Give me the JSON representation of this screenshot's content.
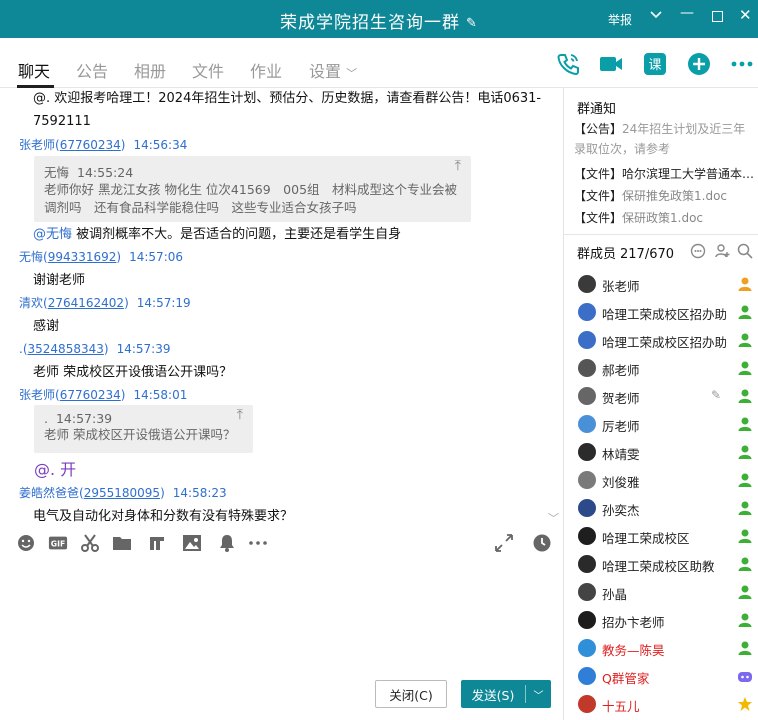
{
  "window": {
    "title": "荣成学院招生咨询一群",
    "report_label": "举报",
    "colors": {
      "titlebar": "#0e8896",
      "accent": "#0a9ea8",
      "link": "#2f6fcf"
    }
  },
  "tabs": [
    {
      "label": "聊天",
      "active": true
    },
    {
      "label": "公告"
    },
    {
      "label": "相册"
    },
    {
      "label": "文件"
    },
    {
      "label": "作业"
    },
    {
      "label": "设置"
    }
  ],
  "chat": {
    "m1_text_line1": "@. 欢迎报考哈理工！2024年招生计划、预估分、历史数据，请查看群公告！电话0631-",
    "m1_text_line2": "7592111",
    "s2": {
      "name": "张老师",
      "qq": "67760234",
      "time": "14:56:34"
    },
    "q2": {
      "name": "无悔",
      "time": "14:55:24",
      "line1": "老师你好 黑龙江女孩 物化生 位次41569　005组　材料成型这个专业会被",
      "line2": "调剂吗　还有食品科学能稳住吗　这些专业适合女孩子吗"
    },
    "m2_at": "@无悔",
    "m2_text": " 被调剂概率不大。是否适合的问题，主要还是看学生自身",
    "s3": {
      "name": "无悔",
      "qq": "994331692",
      "time": "14:57:06"
    },
    "m3_text": "谢谢老师",
    "s4": {
      "name": "清欢",
      "qq": "2764162402",
      "time": "14:57:19"
    },
    "m4_text": "感谢",
    "s5": {
      "name": ".",
      "qq": "3524858343",
      "time": "14:57:39"
    },
    "m5_text": "老师 荣成校区开设俄语公开课吗？",
    "s6": {
      "name": "张老师",
      "qq": "67760234",
      "time": "14:58:01"
    },
    "q6": {
      "name": ".",
      "time": "14:57:39",
      "line1": "老师 荣成校区开设俄语公开课吗？"
    },
    "m6_text": "@. 开",
    "s7": {
      "name": "姜皓然爸爸",
      "qq": "2955180095",
      "time": "14:58:23"
    },
    "m7_text": "电气及自动化对身体和分数有没有特殊要求？"
  },
  "input": {
    "value": ""
  },
  "buttons": {
    "close": "关闭(C)",
    "send": "发送(S)"
  },
  "notice": {
    "title": "群通知",
    "n1_tag": "【公告】",
    "n1_text": "24年招生计划及近三年",
    "n1_text2": "录取位次，请参考",
    "n2": "【文件】哈尔滨理工大学普通本…",
    "n3_tag": "【文件】",
    "n3_text": "保研推免政策1.doc",
    "n4_tag": "【文件】",
    "n4_text": "保研政策1.doc"
  },
  "members": {
    "title": "群成员",
    "count": "217/670",
    "list": [
      {
        "name": "张老师"
      },
      {
        "name": "哈理工荣成校区招办助教"
      },
      {
        "name": "哈理工荣成校区招办助教"
      },
      {
        "name": "郝老师"
      },
      {
        "name": "贺老师"
      },
      {
        "name": "厉老师"
      },
      {
        "name": "林靖雯"
      },
      {
        "name": "刘俊雅"
      },
      {
        "name": "孙奕杰"
      },
      {
        "name": "哈理工荣成校区"
      },
      {
        "name": "哈理工荣成校区助教"
      },
      {
        "name": "孙晶"
      },
      {
        "name": "招办卞老师"
      },
      {
        "name": "教务—陈昊"
      },
      {
        "name": "Q群管家"
      },
      {
        "name": "十五儿"
      }
    ]
  }
}
